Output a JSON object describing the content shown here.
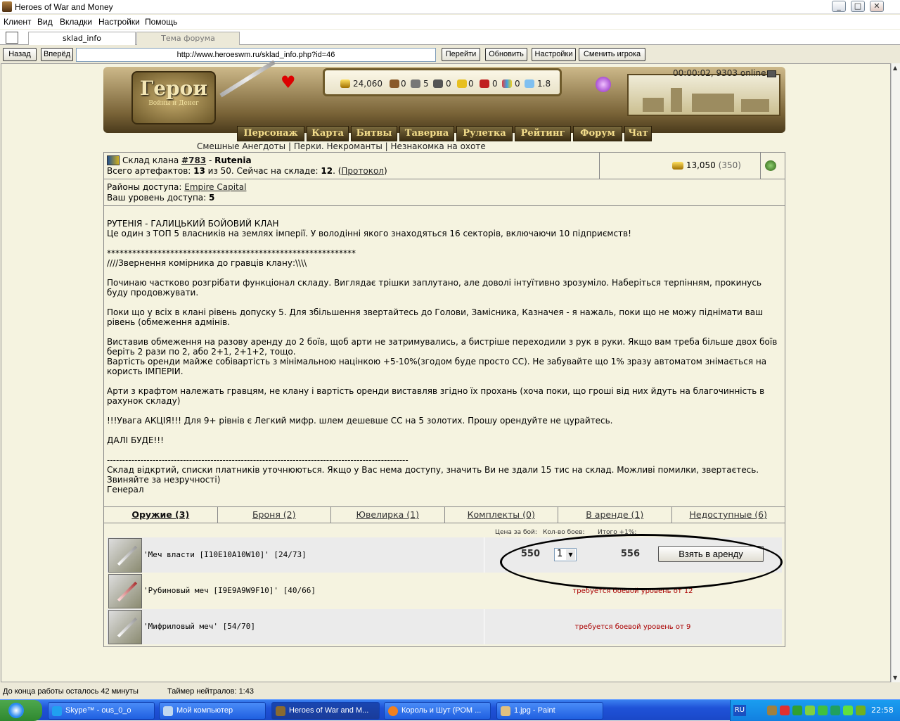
{
  "window": {
    "title": "Heroes of War and Money"
  },
  "menu": [
    "Клиент",
    "Вид",
    "Вкладки",
    "Настройки",
    "Помощь"
  ],
  "browser_tabs": [
    {
      "label": "sklad_info"
    },
    {
      "label": "Тема форума"
    }
  ],
  "nav": {
    "back": "Назад",
    "forward": "Вперёд",
    "url": "http://www.heroeswm.ru/sklad_info.php?id=46",
    "go": "Перейти",
    "refresh": "Обновить",
    "settings": "Настройки",
    "switch": "Сменить игрока"
  },
  "game": {
    "logo_title": "Герои",
    "logo_sub": "Войны и Денег",
    "resources": {
      "gold": "24,060",
      "wood": "0",
      "ore": "5",
      "mercury": "0",
      "sulfur": "0",
      "crystals": "0",
      "gems": "0",
      "diamonds": "1.8"
    },
    "online": "00:00:02, 9303 online",
    "menu": [
      "Персонаж",
      "Карта",
      "Битвы",
      "Таверна",
      "Рулетка",
      "Рейтинг",
      "Форум",
      "Чат"
    ],
    "top_links": "Смешные Анегдоты | Перки. Некроманты | Незнакомка на охоте"
  },
  "clan": {
    "title_prefix": "Склад клана ",
    "clan_id": "#783",
    "dash": " - ",
    "clan_name": "Rutenia",
    "total_prefix": "Всего артефактов: ",
    "total": "13",
    "of": " из 50. Сейчас на складе: ",
    "in_stock": "12",
    "dot": ". (",
    "protocol": "Протокол",
    "close": ")",
    "gold": "13,050",
    "gold_extra": "(350)",
    "districts_label": "Районы доступа: ",
    "district": "Empire Capital",
    "level_label": "Ваш уровень доступа: ",
    "level": "5"
  },
  "description": [
    "РУТЕНІЯ - ГАЛИЦЬКИЙ БОЙОВИЙ КЛАН\nЦе один з ТОП 5 власників на землях імперії. У володінні якого знаходяться 16 секторів, включаючи 10 підприємств!",
    "***********************************************************\n////Звернення комірника до гравців клану:\\\\\\\\",
    "Починаю частково розгрібати функціонал складу. Виглядає трішки заплутано, але доволі інтуїтивно зрозуміло. Наберіться терпінням, прокинусь буду продовжувати.",
    "Поки що у всіх в клані рівень допуску 5. Для збільшення звертайтесь до Голови, Замісника, Казначея - я нажаль, поки що не можу піднімати ваш рівень (обмеження адмінів.",
    "Виставив обмеження на разову аренду до 2 боїв, щоб арти не затримувались, а бистріше переходили з рук в руки. Якщо вам треба більше двох боїв беріть 2 рази по 2, або 2+1, 2+1+2, тощо.\nВартість оренди майже собівартість з мінімальною націнкою +5-10%(згодом буде просто СС). Не забувайте що 1% зразу автоматом знімається на користь ІМПЕРІИ.",
    "Арти з крафтом належать гравцям, не клану і вартість оренди виставляв згідно їх прохань (хоча поки, що гроші від них йдуть на благочинність в рахунок складу)",
    "!!!Увага АКЦІЯ!!! Для 9+ рівнів є Легкий мифр. шлем дешевше СС на 5 золотих. Прошу орендуйте не цурайтесь.",
    "ДАЛІ БУДЕ!!!",
    "---------------------------------------------------------------------------------------------------\nСклад відкртий, списки платників уточнюються. Якщо у Вас нема доступу, значить Ви не здали 15 тис на склад. Можливі помилки, звертаєтесь. Звиняйте за незручності)\nГенерал"
  ],
  "tabs": [
    "Оружие (3)",
    "Броня (2)",
    "Ювелирка (1)",
    "Комплекты (0)",
    "В аренде (1)",
    "Недоступные (6)"
  ],
  "columns": {
    "price": "Цена за бой:",
    "count": "Кол-во боев:",
    "total": "Итого +1%:"
  },
  "items": [
    {
      "name": "'Меч власти [I10E10A10W10]' [24/73]",
      "price": "550",
      "count": "1",
      "total": "556",
      "action": "Взять в аренду"
    },
    {
      "name": "'Рубиновый меч [I9E9A9W9F10]' [40/66]",
      "req": "требуется боевой уровень от 12"
    },
    {
      "name": "'Мифриловый меч' [54/70]",
      "req": "требуется боевой уровень от 9"
    }
  ],
  "status": {
    "left": "До конца работы осталось 42 минуты",
    "timer": "Таймер нейтралов: 1:43"
  },
  "taskbar": {
    "items": [
      "Skype™ - ous_0_o",
      "Мой компьютер",
      "Heroes of War and M...",
      "Король и Шут (РОМ ...",
      "1.jpg - Paint"
    ],
    "lang": "RU",
    "clock": "22:58"
  }
}
